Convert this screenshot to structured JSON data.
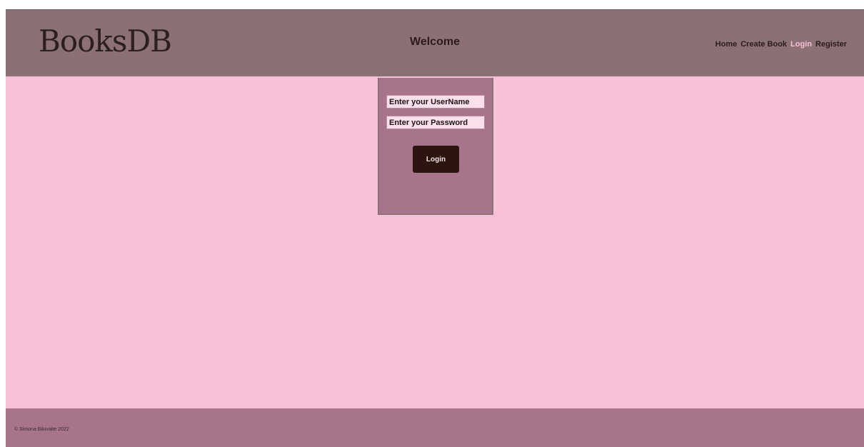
{
  "header": {
    "logo": "BooksDB",
    "welcome": "Welcome",
    "nav": [
      {
        "label": "Home",
        "active": false
      },
      {
        "label": "Create Book",
        "active": false
      },
      {
        "label": "Login",
        "active": true
      },
      {
        "label": "Register",
        "active": false
      }
    ]
  },
  "login_form": {
    "username_placeholder": "Enter your UserName",
    "password_placeholder": "Enter your Password",
    "submit_label": "Login"
  },
  "footer": {
    "copyright": "© Simona Biluvaite 2022"
  },
  "colors": {
    "page_bg": "#f6c1d7",
    "header_bg": "#8b7176",
    "panel_bg": "#a8748b",
    "button_bg": "#2b150e",
    "active_link": "#f6c1d7"
  }
}
